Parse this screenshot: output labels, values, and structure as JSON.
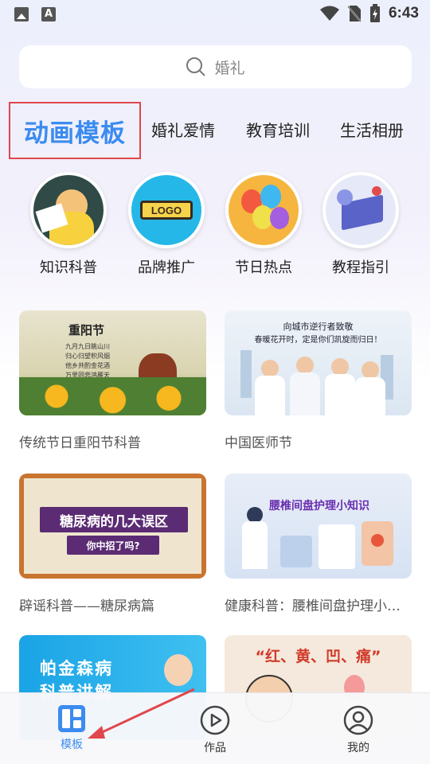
{
  "status_bar": {
    "time": "6:43"
  },
  "search": {
    "placeholder": "婚礼"
  },
  "categories": {
    "active": "动画模板",
    "items": [
      "婚礼爱情",
      "教育培训",
      "生活相册"
    ]
  },
  "circles": [
    {
      "label": "知识科普"
    },
    {
      "label": "品牌推广",
      "logo_text": "LOGO"
    },
    {
      "label": "节日热点"
    },
    {
      "label": "教程指引"
    }
  ],
  "cards": [
    {
      "title": "传统节日重阳节科普",
      "thumb_text": "重阳节",
      "thumb_lines": [
        "九月九日眺山川",
        "归心归望积风烟",
        "他乡共酌金花酒",
        "万里同悲鸿雁天"
      ]
    },
    {
      "title": "中国医师节",
      "thumb_text": "向城市逆行者致敬",
      "thumb_sub": "春暖花开时，定是你们凯旋而归日！"
    },
    {
      "title": "辟谣科普——糖尿病篇",
      "thumb_text": "糖尿病的几大误区",
      "thumb_sub": "你中招了吗?"
    },
    {
      "title": "健康科普：腰椎间盘护理小知识",
      "thumb_text": "腰椎间盘护理小知识"
    },
    {
      "title": "",
      "thumb_text": "帕金森病",
      "thumb_sub": "科普讲解"
    },
    {
      "title": "",
      "thumb_text": "“红、黄、凹、痛”"
    }
  ],
  "bottom_nav": [
    {
      "label": "模板",
      "icon": "template-icon",
      "active": true
    },
    {
      "label": "作品",
      "icon": "play-icon",
      "active": false
    },
    {
      "label": "我的",
      "icon": "user-icon",
      "active": false
    }
  ],
  "colors": {
    "accent": "#3b8bf0",
    "highlight_border": "#e0474c",
    "arrow": "#e0474c"
  }
}
